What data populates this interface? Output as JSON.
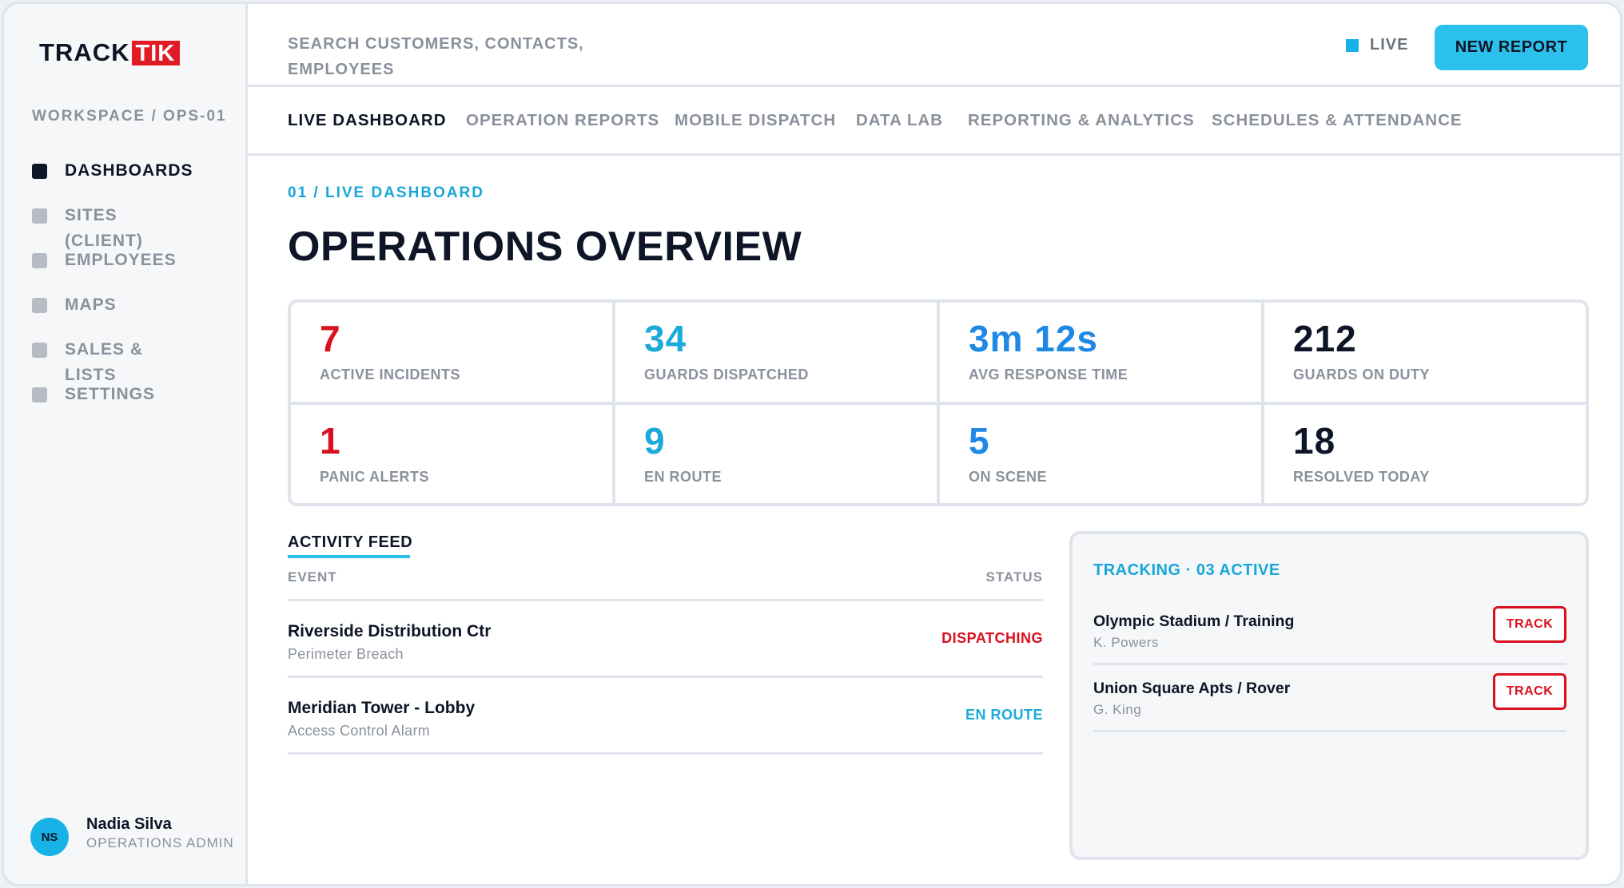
{
  "brand": {
    "logo_part1": "TRACK",
    "logo_part2": "TIK",
    "accent": "#e01b24"
  },
  "sidebar": {
    "workspace": "WORKSPACE / OPS-01",
    "items": [
      {
        "label": "DASHBOARDS",
        "active": true
      },
      {
        "label": "SITES"
      },
      {
        "label": "EMPLOYEES"
      },
      {
        "label": "MAPS"
      },
      {
        "label": "SALES &"
      },
      {
        "label": "SETTINGS"
      }
    ],
    "extra_text_1": "(CLIENT)",
    "extra_text_2": "LISTS"
  },
  "user": {
    "initials": "NS",
    "name": "Nadia Silva",
    "role": "OPERATIONS ADMIN"
  },
  "topbar": {
    "search_placeholder": "SEARCH CUSTOMERS, CONTACTS, EMPLOYEES",
    "live_label": "LIVE",
    "new_report_label": "NEW REPORT"
  },
  "tabs": [
    {
      "label": "LIVE DASHBOARD",
      "active": true
    },
    {
      "label": "OPERATION REPORTS"
    },
    {
      "label": "MOBILE DISPATCH"
    },
    {
      "label": "DATA LAB"
    },
    {
      "label": "REPORTING & ANALYTICS"
    },
    {
      "label": "SCHEDULES & ATTENDANCE"
    }
  ],
  "main": {
    "breadcrumb": "01 / LIVE DASHBOARD",
    "title": "OPERATIONS OVERVIEW"
  },
  "kpis": [
    {
      "value": "7",
      "label": "ACTIVE INCIDENTS",
      "color": "#d9101d"
    },
    {
      "value": "34",
      "label": "GUARDS DISPATCHED",
      "color": "#1baad9"
    },
    {
      "value": "3m 12s",
      "label": "AVG RESPONSE TIME",
      "color": "#1e88e5"
    },
    {
      "value": "212",
      "label": "GUARDS ON DUTY",
      "color": "#0d1526"
    },
    {
      "value": "1",
      "label": "PANIC ALERTS",
      "color": "#d9101d"
    },
    {
      "value": "9",
      "label": "EN ROUTE",
      "color": "#1baad9"
    },
    {
      "value": "5",
      "label": "ON SCENE",
      "color": "#1e88e5"
    },
    {
      "value": "18",
      "label": "RESOLVED TODAY",
      "color": "#0d1526"
    }
  ],
  "feed": {
    "title": "ACTIVITY FEED",
    "col_event": "EVENT",
    "col_status": "STATUS",
    "rows": [
      {
        "event": "Riverside Distribution Ctr",
        "sub": "Perimeter Breach",
        "status": "DISPATCHING",
        "status_color": "#d9101d"
      },
      {
        "event": "Meridian Tower - Lobby",
        "sub": "Access Control Alarm",
        "status": "EN ROUTE",
        "status_color": "#1baad9"
      }
    ]
  },
  "tracking": {
    "title": "TRACKING · 03 ACTIVE",
    "rows": [
      {
        "name": "Olympic Stadium / Training",
        "person": "K. Powers",
        "button": "TRACK"
      },
      {
        "name": "Union Square Apts / Rover",
        "person": "G. King",
        "button": "TRACK"
      }
    ]
  }
}
